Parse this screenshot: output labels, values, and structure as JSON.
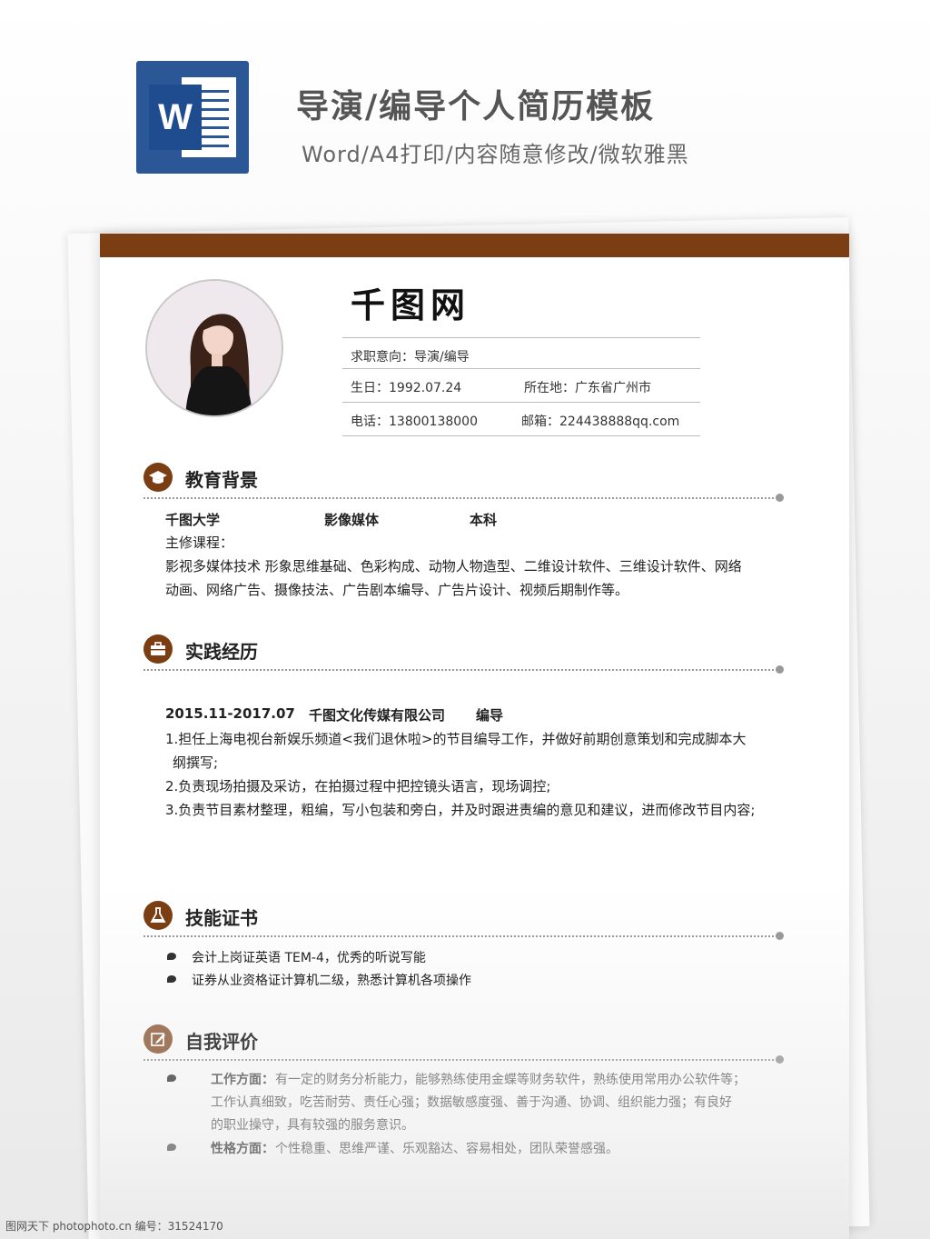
{
  "banner": {
    "icon": "word-icon",
    "icon_letter": "W",
    "title": "导演/编导个人简历模板",
    "subtitle": "Word/A4打印/内容随意修改/微软雅黑"
  },
  "resume": {
    "name": "千图网",
    "objective": "求职意向：导演/编导",
    "birth": "生日：1992.07.24",
    "location": "所在地：广东省广州市",
    "phone": "电话：13800138000",
    "email": "邮箱：224438888qq.com",
    "colors": {
      "accent": "#7a3e12"
    }
  },
  "education": {
    "title": "教育背景",
    "icon": "graduation-cap-icon",
    "school": "千图大学",
    "major": "影像媒体",
    "degree": "本科",
    "courses_label": "主修课程：",
    "courses_line1": "影视多媒体技术 形象思维基础、色彩构成、动物人物造型、二维设计软件、三维设计软件、网络",
    "courses_line2": "动画、网络广告、摄像技法、广告剧本编导、广告片设计、视频后期制作等。"
  },
  "experience": {
    "title": "实践经历",
    "icon": "briefcase-icon",
    "period": "2015.11-2017.07",
    "company": "千图文化传媒有限公司",
    "role": "编导",
    "item1_line1": "1.担任上海电视台新娱乐频道<我们退休啦>的节目编导工作，并做好前期创意策划和完成脚本大",
    "item1_line2": "纲撰写;",
    "item2": "2.负责现场拍摄及采访，在拍摄过程中把控镜头语言，现场调控;",
    "item3": "3.负责节目素材整理，粗编，写小包装和旁白，并及时跟进责编的意见和建议，进而修改节目内容;"
  },
  "skills": {
    "title": "技能证书",
    "icon": "flask-icon",
    "items": [
      "会计上岗证英语 TEM-4，优秀的听说写能",
      "证券从业资格证计算机二级，熟悉计算机各项操作"
    ]
  },
  "evaluation": {
    "title": "自我评价",
    "icon": "edit-icon",
    "work_label": "工作方面：",
    "work_line1": "有一定的财务分析能力，能够熟练使用金蝶等财务软件，熟练使用常用办公软件等；",
    "work_line2": "工作认真细致，吃苦耐劳、责任心强；数据敏感度强、善于沟通、协调、组织能力强；有良好",
    "work_line3": "的职业操守，具有较强的服务意识。",
    "personality_label": "性格方面：",
    "personality_text": "个性稳重、思维严谨、乐观豁达、容易相处，团队荣誉感强。"
  },
  "footer": {
    "credit": "图网天下 photophoto.cn    编号：31524170"
  }
}
